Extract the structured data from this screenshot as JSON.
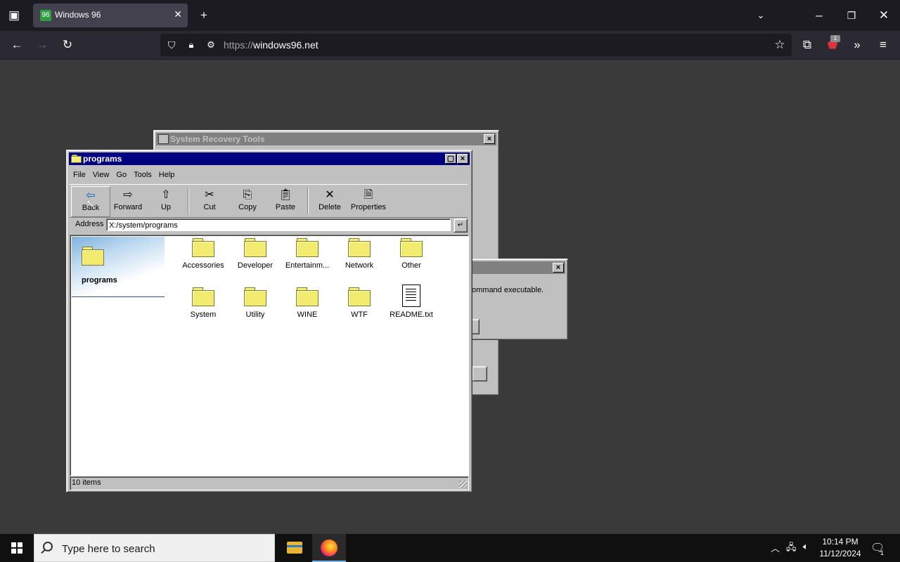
{
  "browser": {
    "tab_title": "Windows 96",
    "url_scheme": "https://",
    "url_host": "windows96.net",
    "extension_badge": "1"
  },
  "recovery_window": {
    "title": "System Recovery Tools"
  },
  "cmd_dialog": {
    "message": "ommand executable."
  },
  "explorer": {
    "title": "programs",
    "menu": [
      "File",
      "View",
      "Go",
      "Tools",
      "Help"
    ],
    "toolbar": {
      "back": "Back",
      "forward": "Forward",
      "up": "Up",
      "cut": "Cut",
      "copy": "Copy",
      "paste": "Paste",
      "delete": "Delete",
      "properties": "Properties"
    },
    "address_label": "Address",
    "address_value": "X:/system/programs",
    "sidebar_title": "programs",
    "items": [
      {
        "name": "Accessories",
        "type": "folder"
      },
      {
        "name": "Developer",
        "type": "folder"
      },
      {
        "name": "Entertainm...",
        "type": "folder"
      },
      {
        "name": "Network",
        "type": "folder"
      },
      {
        "name": "Other",
        "type": "folder"
      },
      {
        "name": "System",
        "type": "folder"
      },
      {
        "name": "Utility",
        "type": "folder"
      },
      {
        "name": "WINE",
        "type": "folder"
      },
      {
        "name": "WTF",
        "type": "folder"
      },
      {
        "name": "README.txt",
        "type": "text-file"
      }
    ],
    "status": "10 items"
  },
  "taskbar": {
    "search_placeholder": "Type here to search",
    "time": "10:14 PM",
    "date": "11/12/2024",
    "notification_count": "1"
  }
}
